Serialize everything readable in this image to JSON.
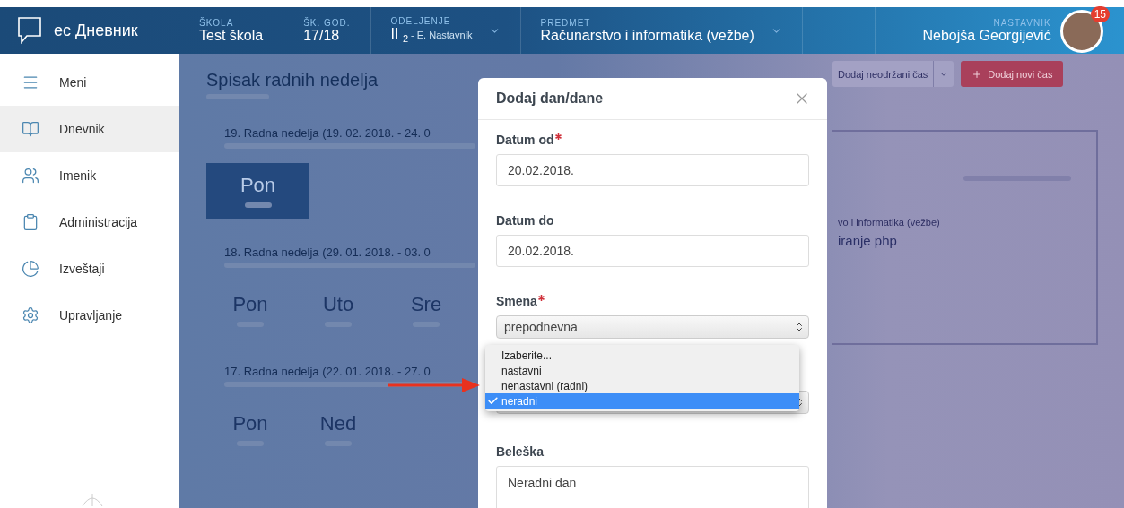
{
  "header": {
    "logo": "ес Дневник",
    "fields": [
      {
        "label": "ŠKOLA",
        "value": "Test škola",
        "dropdown": false
      },
      {
        "label": "ŠK. GOD.",
        "value": "17/18",
        "dropdown": false
      },
      {
        "label": "ODELJENJE",
        "value": "II $_{2}$",
        "note": "- E. Nastavnik",
        "dropdown": true
      },
      {
        "label": "PREDMET",
        "value": "Računarstvo i informatika (vežbe)",
        "dropdown": true
      }
    ],
    "user": {
      "role": "NASTAVNIK",
      "name": "Nebojša Georgijević",
      "badge": "15"
    }
  },
  "sidebar": {
    "items": [
      {
        "label": "Meni",
        "selected": false
      },
      {
        "label": "Dnevnik",
        "selected": true
      },
      {
        "label": "Imenik",
        "selected": false
      },
      {
        "label": "Administracija",
        "selected": false
      },
      {
        "label": "Izveštaji",
        "selected": false
      },
      {
        "label": "Upravljanje",
        "selected": false
      }
    ]
  },
  "page": {
    "title": "Spisak radnih nedelja",
    "weeks": [
      {
        "title": "19. Radna nedelja (19. 02. 2018. - 24. 0",
        "days": [
          {
            "label": "Pon",
            "selected": true
          }
        ]
      },
      {
        "title": "18. Radna nedelja (29. 01. 2018. - 03. 0",
        "days": [
          {
            "label": "Pon",
            "selected": false
          },
          {
            "label": "Uto",
            "selected": false
          },
          {
            "label": "Sre",
            "selected": false
          }
        ]
      },
      {
        "title": "17. Radna nedelja (22. 01. 2018. - 27. 0",
        "days": [
          {
            "label": "Pon",
            "selected": false
          },
          {
            "label": "Ned",
            "selected": false
          }
        ]
      }
    ],
    "buttons": [
      {
        "label": "Dodaj neodržani čas",
        "kind": "split"
      },
      {
        "label": "Dodaj novi čas",
        "kind": "primary"
      }
    ],
    "card": {
      "subject": "vo i informatika (vežbe)",
      "topic": "iranje php"
    }
  },
  "modal": {
    "title": "Dodaj dan/dane",
    "fields": [
      {
        "kind": "input",
        "label": "Datum od",
        "required": true,
        "value": "20.02.2018."
      },
      {
        "kind": "input",
        "label": "Datum do",
        "required": false,
        "value": "20.02.2018."
      },
      {
        "kind": "select",
        "label": "Smena",
        "required": true,
        "value": "prepodnevna"
      },
      {
        "kind": "select",
        "open": true,
        "options": [
          {
            "label": "Izaberite...",
            "selected": false
          },
          {
            "label": "nastavni",
            "selected": false
          },
          {
            "label": "nenastavni (radni)",
            "selected": false
          },
          {
            "label": "neradni",
            "selected": true
          }
        ]
      },
      {
        "kind": "textarea",
        "label": "Beleška",
        "required": false,
        "value": "Neradni dan"
      }
    ]
  }
}
